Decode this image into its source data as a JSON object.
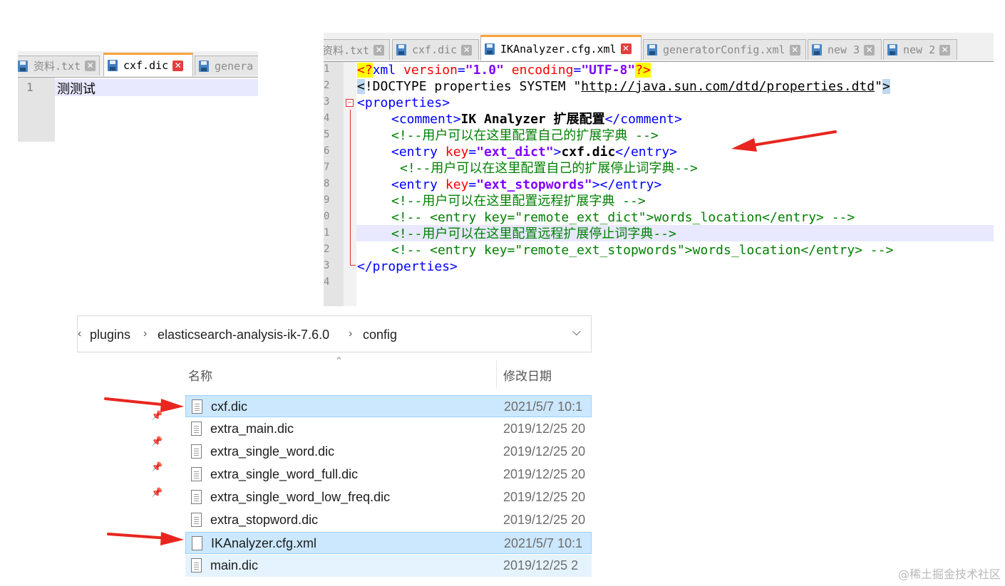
{
  "small_editor": {
    "tabs": [
      {
        "label": "资料.txt",
        "active": false
      },
      {
        "label": "cxf.dic",
        "active": true
      },
      {
        "label": "genera",
        "active": false
      }
    ],
    "line_number": "1",
    "content": "测测试"
  },
  "big_editor": {
    "tabs": [
      {
        "label": "资料.txt",
        "active": false
      },
      {
        "label": "cxf.dic",
        "active": false
      },
      {
        "label": "IKAnalyzer.cfg.xml",
        "active": true
      },
      {
        "label": "generatorConfig.xml",
        "active": false
      },
      {
        "label": "new 3",
        "active": false
      },
      {
        "label": "new 2",
        "active": false
      }
    ],
    "line_numbers": [
      "1",
      "2",
      "3",
      "4",
      "5",
      "6",
      "7",
      "8",
      "9",
      "0",
      "1",
      "2",
      "3",
      "4"
    ],
    "code": {
      "l1": {
        "pi_open": "<?",
        "name": "xml",
        "attr1": "version",
        "val1": "\"1.0\"",
        "attr2": "encoding",
        "val2": "\"UTF-8\"",
        "pi_close": "?>"
      },
      "l2": {
        "lt": "<",
        "doctype": "!DOCTYPE properties SYSTEM ",
        "q1": "\"",
        "url": "http://java.sun.com/dtd/properties.dtd",
        "q2": "\"",
        "gt": ">"
      },
      "l3": "<properties>",
      "l4": {
        "open": "<comment>",
        "text": "IK Analyzer 扩展配置",
        "close": "</comment>"
      },
      "l5": "<!--用户可以在这里配置自己的扩展字典 -->",
      "l6": {
        "open": "<entry ",
        "attr": "key",
        "eq": "=",
        "val": "\"ext_dict\"",
        "gt": ">",
        "text": "cxf.dic",
        "close": "</entry>"
      },
      "l7": "<!--用户可以在这里配置自己的扩展停止词字典-->",
      "l8": {
        "open": "<entry ",
        "attr": "key",
        "eq": "=",
        "val": "\"ext_stopwords\"",
        "gt": ">",
        "close": "</entry>"
      },
      "l9": "<!--用户可以在这里配置远程扩展字典 -->",
      "l10": "<!-- <entry key=\"remote_ext_dict\">words_location</entry> -->",
      "l11": "<!--用户可以在这里配置远程扩展停止词字典-->",
      "l12": "<!-- <entry key=\"remote_ext_stopwords\">words_location</entry> -->",
      "l13": "</properties>"
    }
  },
  "explorer": {
    "breadcrumb": [
      "plugins",
      "elasticsearch-analysis-ik-7.6.0",
      "config"
    ],
    "col_name": "名称",
    "col_date": "修改日期",
    "files": [
      {
        "name": "cxf.dic",
        "date": "2021/5/7 10:1",
        "state": "selected"
      },
      {
        "name": "extra_main.dic",
        "date": "2019/12/25 20",
        "state": "normal"
      },
      {
        "name": "extra_single_word.dic",
        "date": "2019/12/25 20",
        "state": "normal"
      },
      {
        "name": "extra_single_word_full.dic",
        "date": "2019/12/25 20",
        "state": "normal"
      },
      {
        "name": "extra_single_word_low_freq.dic",
        "date": "2019/12/25 20",
        "state": "normal"
      },
      {
        "name": "extra_stopword.dic",
        "date": "2019/12/25 20",
        "state": "normal"
      },
      {
        "name": "IKAnalyzer.cfg.xml",
        "date": "2021/5/7 10:1",
        "state": "selected"
      },
      {
        "name": "main.dic",
        "date": "2019/12/25 2",
        "state": "hover"
      }
    ]
  },
  "watermark": "@稀土掘金技术社区",
  "colors": {
    "accent_tab": "#f9a33b",
    "arrow": "#e8261f",
    "selection": "#cce8ff"
  }
}
